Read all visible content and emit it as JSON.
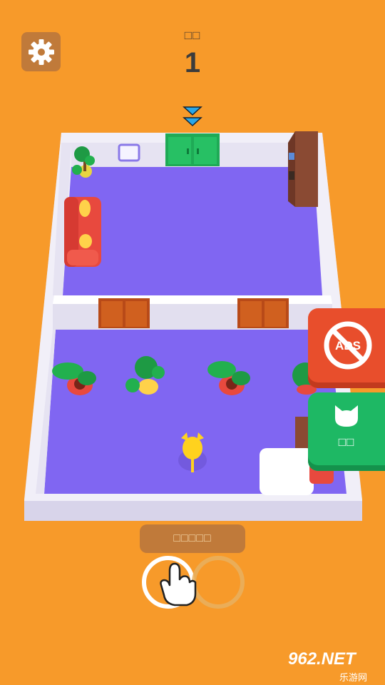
{
  "hud": {
    "level_label": "□□",
    "level_number": "1"
  },
  "buttons": {
    "settings_icon": "gear-icon",
    "no_ads_text": "ADS",
    "skins_label": "□□"
  },
  "hint": {
    "text": "□□□□□"
  },
  "watermark": {
    "brand": "962.NET",
    "sub": "乐游网"
  },
  "colors": {
    "background": "#F79A2A",
    "floor": "#8066F2",
    "wall": "#E6E3F2",
    "no_ads_button": "#E84E2C",
    "skins_button": "#1EB864",
    "player": "#FFD21E"
  }
}
